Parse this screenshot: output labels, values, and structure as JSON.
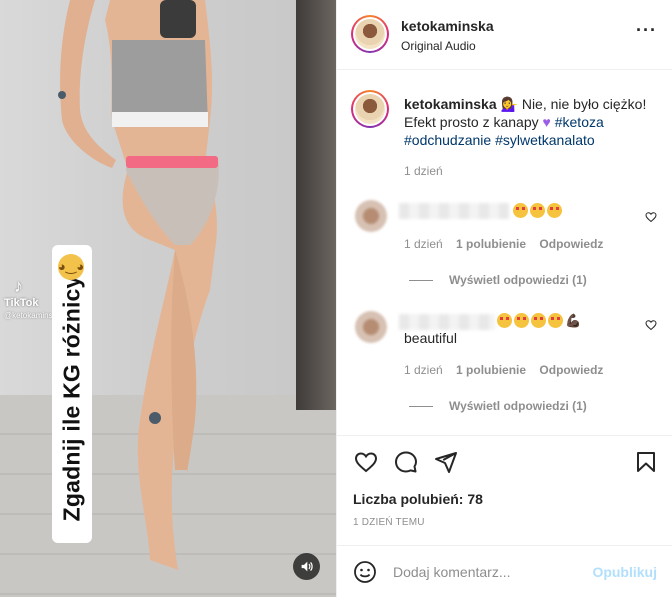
{
  "media": {
    "caption_text": "Zgadnij ile KG różnicy!",
    "tiktok_label": "TikTok",
    "tiktok_handle": "@ketokaminska"
  },
  "header": {
    "username": "ketokaminska",
    "audio_label": "Original Audio",
    "more_icon": "more-horizontal-icon"
  },
  "caption": {
    "username": "ketokaminska",
    "text_part1": "Nie, nie było ciężko! Efekt prosto z kanapy",
    "hashtags": [
      "#ketoza",
      "#odchudzanie",
      "#sylwetkanalato"
    ],
    "time": "1 dzień"
  },
  "comments": [
    {
      "text": "",
      "time": "1 dzień",
      "likes": "1 polubienie",
      "reply": "Odpowiedz",
      "view_replies": "Wyświetl odpowiedzi (1)"
    },
    {
      "text": "beautiful",
      "time": "1 dzień",
      "likes": "1 polubienie",
      "reply": "Odpowiedz",
      "view_replies": "Wyświetl odpowiedzi (1)"
    }
  ],
  "actions": {
    "likes_count": "Liczba polubień: 78",
    "timestamp": "1 DZIEŃ TEMU"
  },
  "add_comment": {
    "placeholder": "Dodaj komentarz...",
    "publish_label": "Opublikuj"
  },
  "colors": {
    "link": "#00376b",
    "muted": "#8e8e8e",
    "publish_disabled": "#b2dffc"
  }
}
